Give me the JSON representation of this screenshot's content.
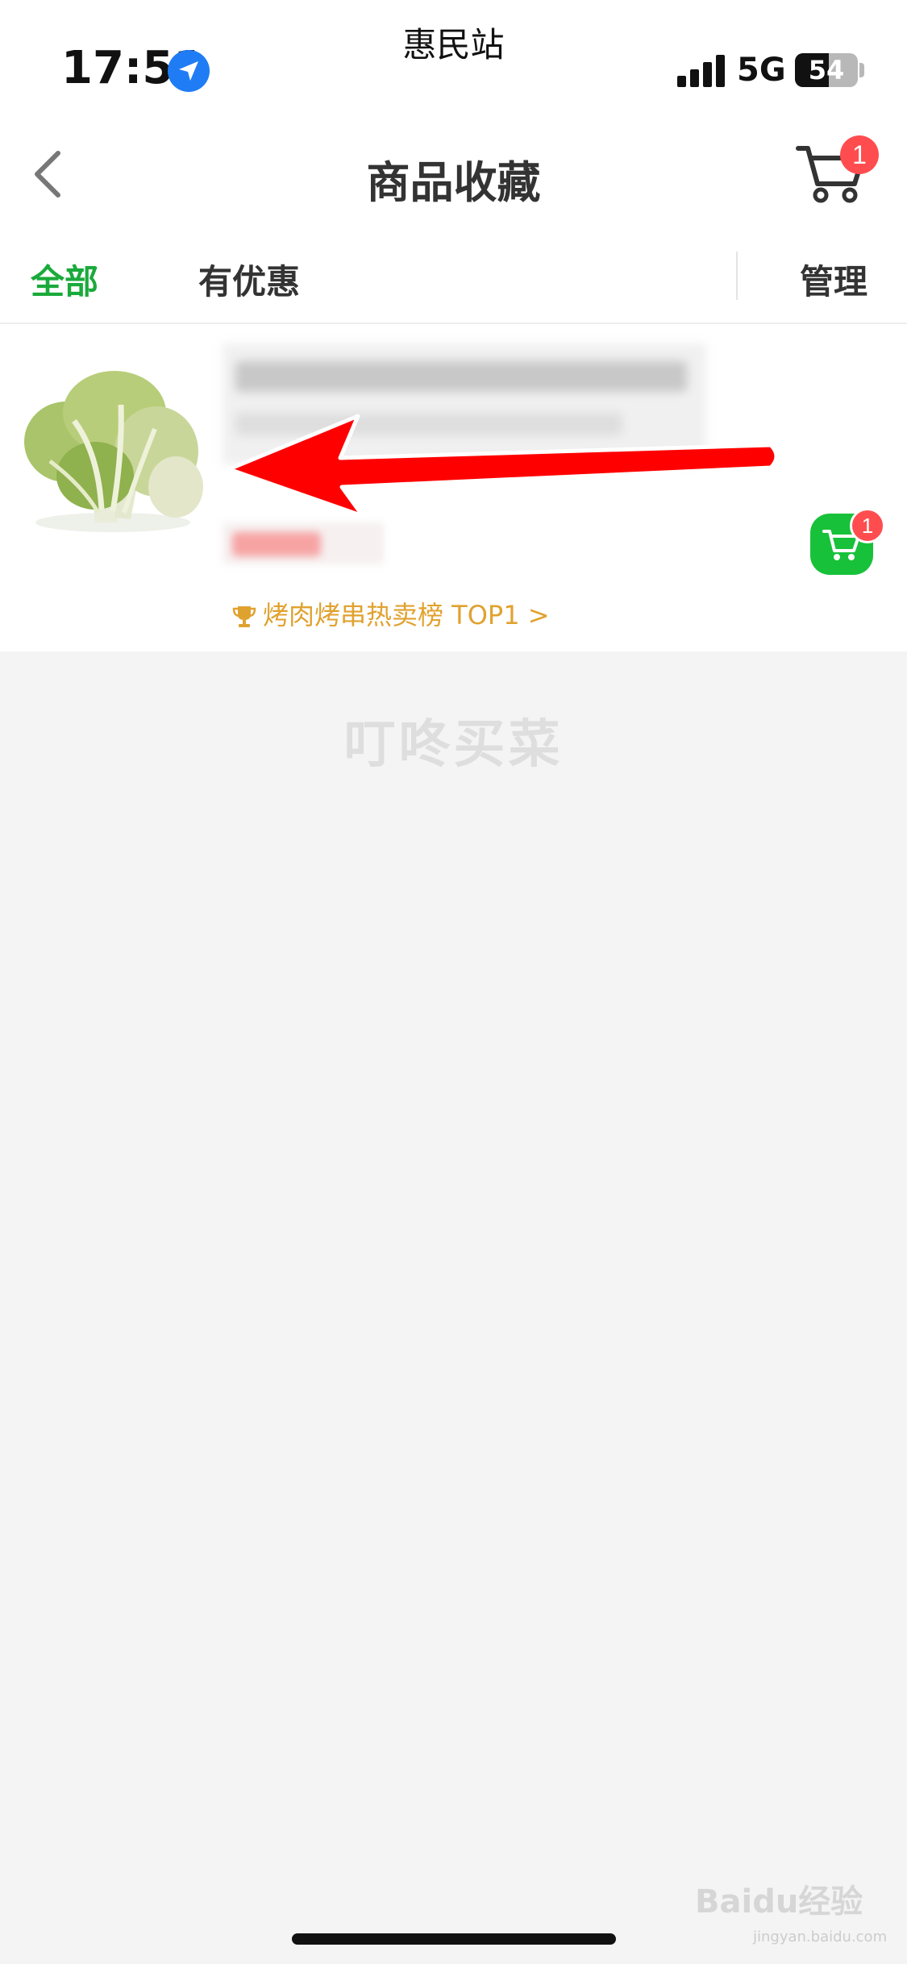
{
  "status_bar": {
    "carrier_label": "惠民站",
    "time": "17:51",
    "network": "5G",
    "battery_percent": "54",
    "battery_level": 0.54
  },
  "nav": {
    "title": "商品收藏",
    "cart_badge": "1",
    "icons": {
      "back": "chevron-left-icon",
      "cart": "shopping-cart-icon"
    }
  },
  "tabs": {
    "all_label": "全部",
    "deals_label": "有优惠",
    "manage_label": "管理",
    "active_color": "#1aaa3b"
  },
  "product": {
    "image": "cauliflower",
    "add_cart_badge": "1",
    "rank_label": "烤肉烤串热卖榜 TOP1 >",
    "accent_color": "#17c13a",
    "rank_color": "#e0a22f"
  },
  "watermarks": {
    "brand": "叮咚买菜",
    "baidu": "Baidu经验",
    "baidu_sub": "jingyan.baidu.com"
  }
}
